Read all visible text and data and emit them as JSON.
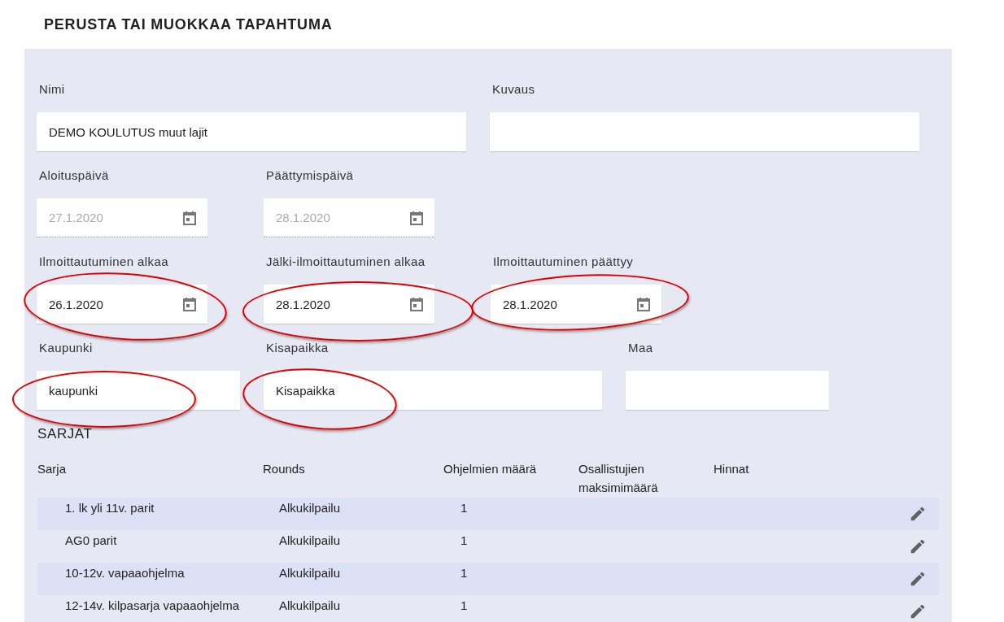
{
  "title": "PERUSTA TAI MUOKKAA TAPAHTUMA",
  "field_rows": [
    [
      {
        "label": "Nimi",
        "kind": "text",
        "value": "DEMO KOULUTUS muut lajit",
        "disabled": false,
        "circled": false
      },
      {
        "label": "Kuvaus",
        "kind": "text",
        "disabled": false,
        "circled": false
      }
    ],
    [
      {
        "label": "Aloituspäivä",
        "kind": "date",
        "value": "27.1.2020",
        "disabled": true,
        "circled": false
      },
      {
        "label": "Päättymispäivä",
        "kind": "date",
        "value": "28.1.2020",
        "disabled": true,
        "circled": false
      }
    ],
    [
      {
        "label": "Ilmoittautuminen alkaa",
        "kind": "date",
        "value": "26.1.2020",
        "disabled": false,
        "circled": true
      },
      {
        "label": "Jälki-ilmoittautuminen alkaa",
        "kind": "date",
        "value": "28.1.2020",
        "disabled": false,
        "circled": true
      },
      {
        "label": "Ilmoittautuminen päättyy",
        "kind": "date",
        "value": "28.1.2020",
        "disabled": false,
        "circled": true
      }
    ],
    [
      {
        "label": "Kaupunki",
        "kind": "text",
        "value": "kaupunki",
        "disabled": false,
        "circled": true
      },
      {
        "label": "Kisapaikka",
        "kind": "text",
        "value": "Kisapaikka",
        "disabled": false,
        "circled": true
      },
      {
        "label": "Maa",
        "kind": "text",
        "disabled": false,
        "circled": false
      }
    ]
  ],
  "series_section": {
    "title": "SARJAT",
    "columns": [
      "Sarja",
      "Rounds",
      "Ohjelmien määrä",
      "Osallistujien maksimimäärä",
      "Hinnat"
    ],
    "rows": [
      {
        "name": "1. lk yli 11v. parit",
        "rounds": "Alkukilpailu",
        "programs": "1"
      },
      {
        "name": "AG0 parit",
        "rounds": "Alkukilpailu",
        "programs": "1"
      },
      {
        "name": "10-12v. vapaaohjelma",
        "rounds": "Alkukilpailu",
        "programs": "1"
      },
      {
        "name": "12-14v. kilpasarja vapaaohjelma",
        "rounds": "Alkukilpailu",
        "programs": "1"
      }
    ]
  }
}
